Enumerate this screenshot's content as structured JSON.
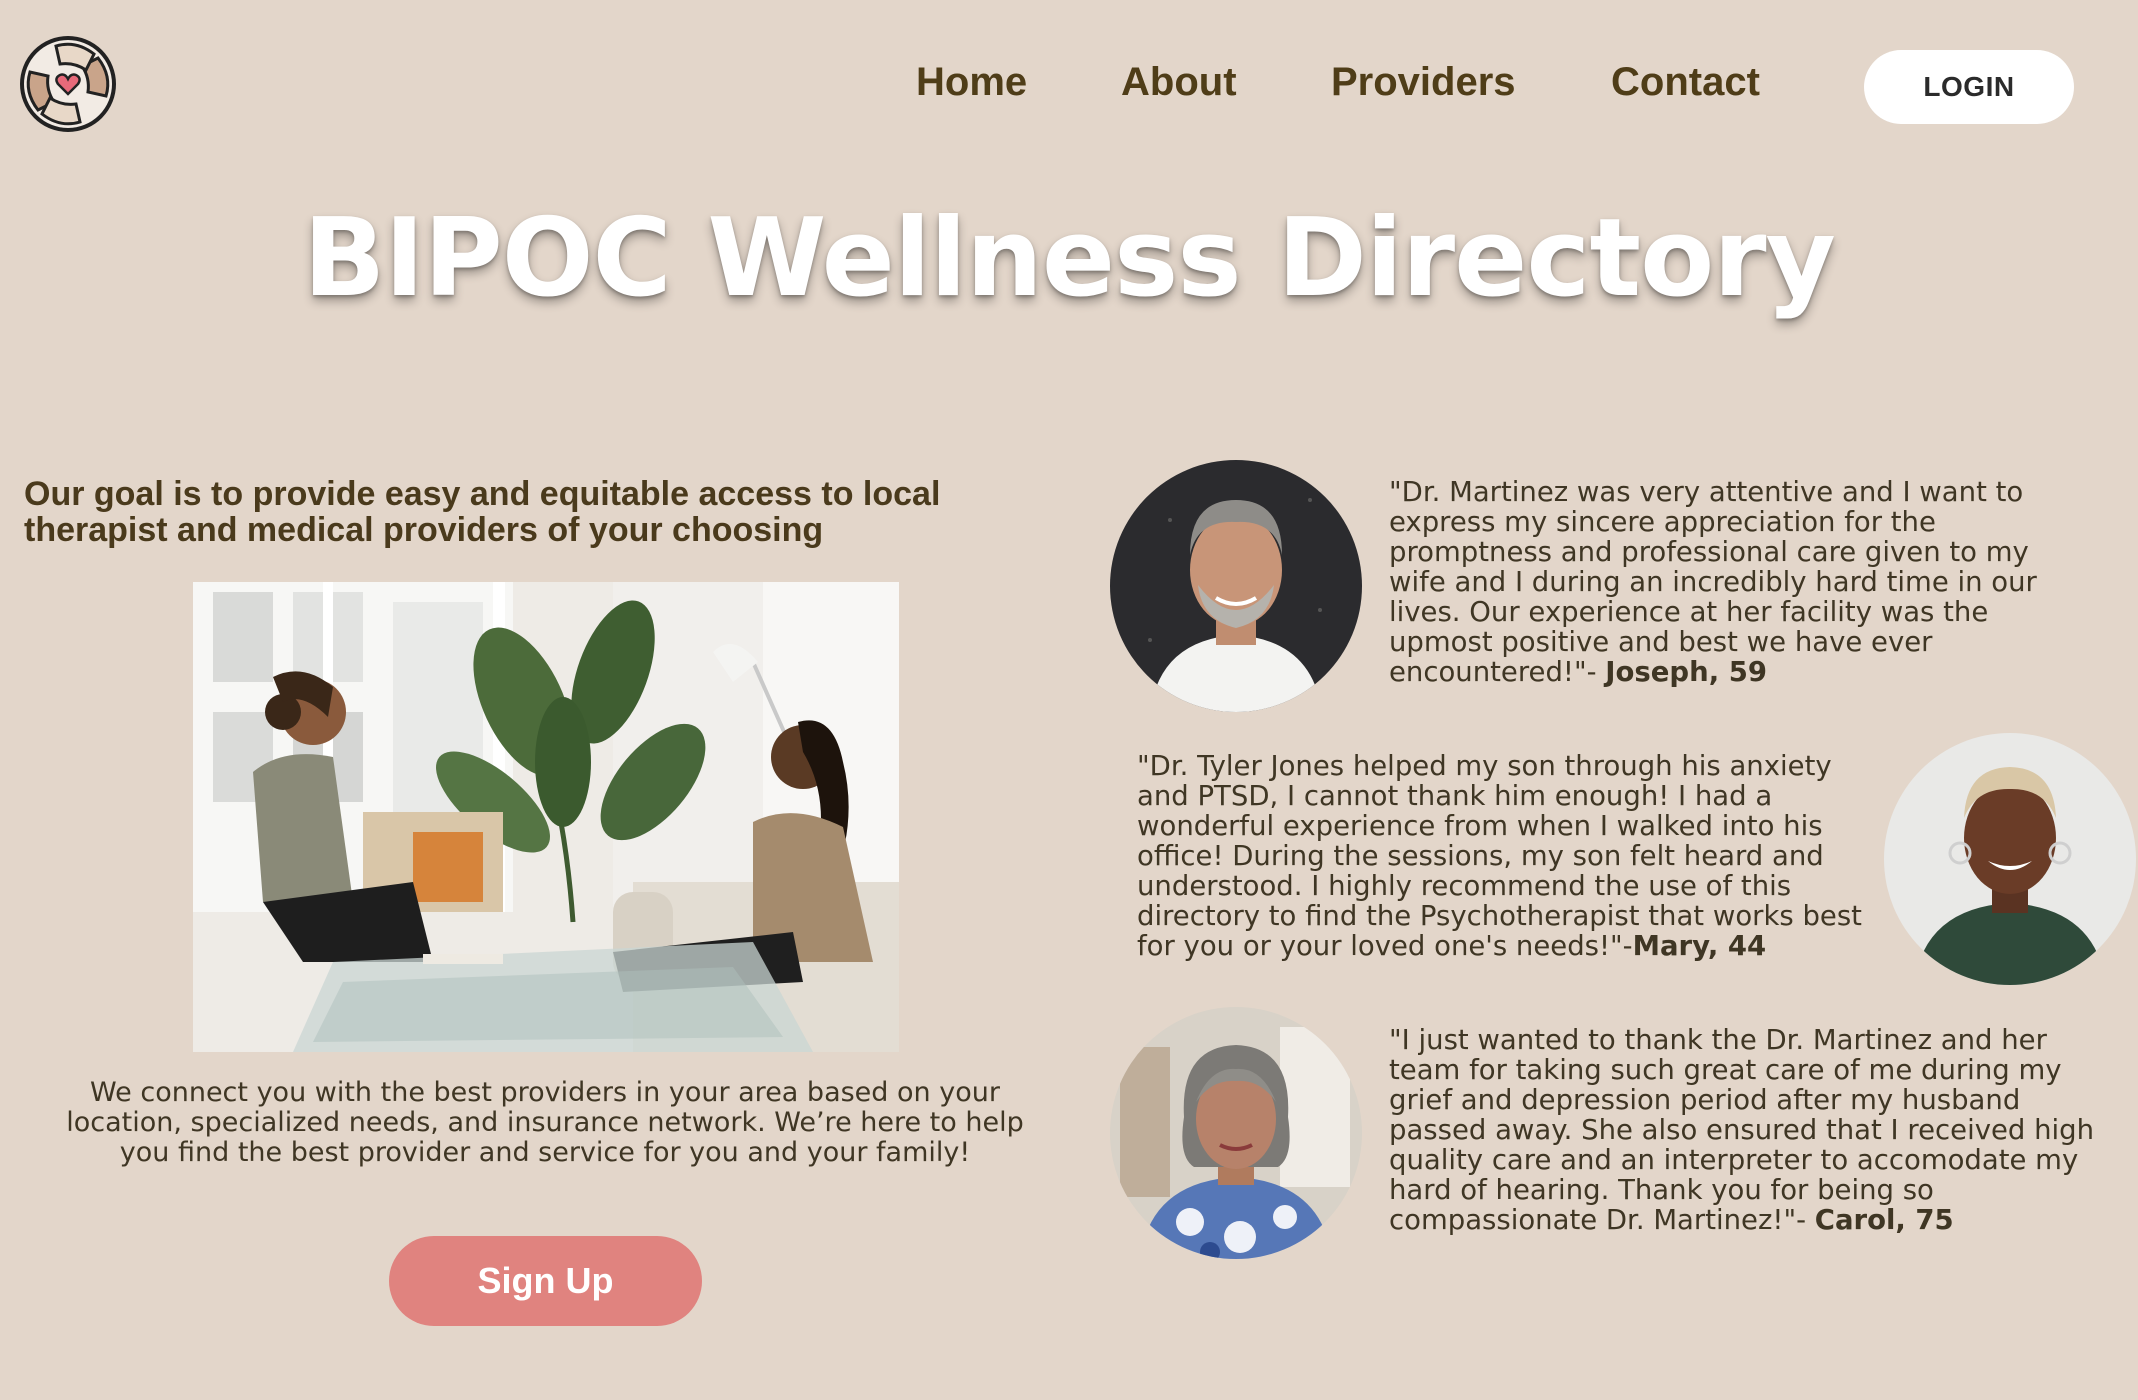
{
  "nav": {
    "links": [
      "Home",
      "About",
      "Providers",
      "Contact"
    ],
    "login_label": "LOGIN"
  },
  "hero": {
    "title": "BIPOC Wellness Directory"
  },
  "intro": {
    "goal": "Our goal is to provide easy and equitable access to local therapist and medical providers of your choosing",
    "connect": "We connect you with the best providers in your area based on your location, specialized needs, and insurance network. We’re here to help you find the best provider and service for you and your family!",
    "signup_label": "Sign Up"
  },
  "testimonials": [
    {
      "quote": "\"Dr. Martinez was very attentive and I want to express my sincere appreciation for the promptness and professional care given to my wife and I during an incredibly hard time in our lives. Our experience at her facility was the upmost positive and best we have ever encountered!\"- ",
      "author": "Joseph, 59"
    },
    {
      "quote": "\"Dr. Tyler Jones helped my son through his anxiety and PTSD, I cannot thank him enough! I had a wonderful experience from when I walked into his office! During the sessions, my son felt heard and understood. I highly recommend the use of this directory to find the Psychotherapist that works best for you or your loved one's needs!\"-",
      "author": "Mary, 44"
    },
    {
      "quote": "\"I just wanted to thank the Dr. Martinez and her team for taking such great care of me during my grief and depression period after my husband passed away. She also ensured that I received high quality care and an interpreter to accomodate my hard of hearing. Thank you for being so compassionate Dr. Martinez!\"- ",
      "author": "Carol, 75"
    }
  ],
  "colors": {
    "background": "#e3d6ca",
    "nav_text": "#4f3d18",
    "signup_button": "#e0837f",
    "login_button": "#ffffff",
    "title": "#ffffff"
  },
  "icons": {
    "logo": "hands-heart-logo-icon"
  }
}
